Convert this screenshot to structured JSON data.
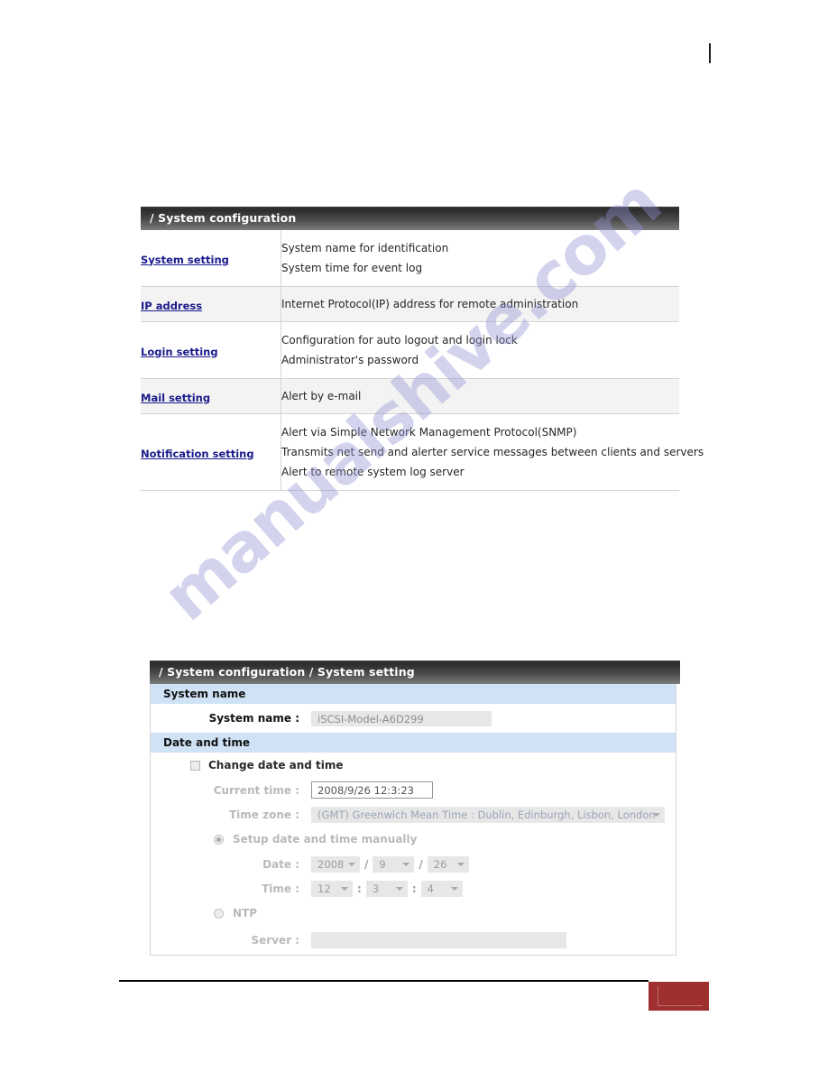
{
  "watermark": {
    "text": "manualshive.com"
  },
  "overview_panel": {
    "header": "/ System configuration",
    "rows": [
      {
        "link": "System setting",
        "descriptions": [
          "System name for identification",
          "System time for event log"
        ]
      },
      {
        "link": "IP address",
        "descriptions": [
          "Internet Protocol(IP) address for remote administration"
        ]
      },
      {
        "link": "Login setting",
        "descriptions": [
          "Configuration for auto logout and login lock",
          "Administrator's password"
        ]
      },
      {
        "link": "Mail setting",
        "descriptions": [
          "Alert by e-mail"
        ]
      },
      {
        "link": "Notification setting",
        "descriptions": [
          "Alert via Simple Network Management Protocol(SNMP)",
          "Transmits net send and alerter service messages between clients and servers",
          "Alert to remote system log server"
        ]
      }
    ]
  },
  "setting_panel": {
    "header": "/ System configuration / System setting",
    "system_name_section": {
      "title": "System name",
      "label": "System name :",
      "value": "iSCSI-Model-A6D299"
    },
    "date_time_section": {
      "title": "Date and time",
      "change_checkbox_label": "Change date and time",
      "current_time_label": "Current time :",
      "current_time_value": "2008/9/26 12:3:23",
      "time_zone_label": "Time zone :",
      "time_zone_value": "(GMT) Greenwich Mean Time : Dublin, Edinburgh, Lisbon, London",
      "manual_radio_label": "Setup date and time manually",
      "date_label": "Date :",
      "date_year": "2008",
      "date_month": "9",
      "date_day": "26",
      "date_sep": "/",
      "time_label": "Time :",
      "time_hour": "12",
      "time_minute": "3",
      "time_second": "4",
      "time_sep": ":",
      "ntp_radio_label": "NTP",
      "server_label": "Server :",
      "server_value": ""
    }
  },
  "colors": {
    "header_bar_dark": "#2b2b2b",
    "header_bar_light": "#7d7d7d",
    "section_blue": "#cfe2f6",
    "link_blue": "#1a1a8c",
    "footer_box_red": "#a03030",
    "watermark_purple": "#9292d4"
  }
}
